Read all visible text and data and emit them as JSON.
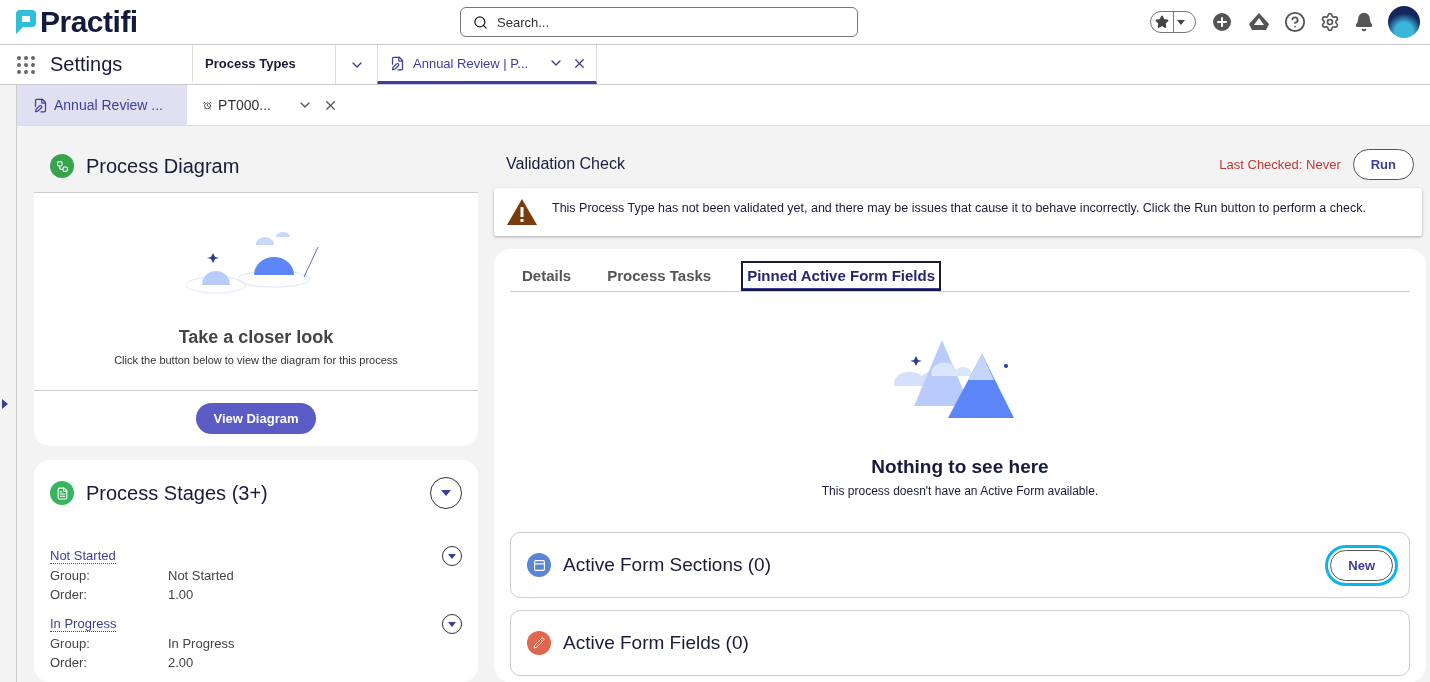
{
  "header": {
    "logo": "Practifi",
    "search": {
      "placeholder": "Search..."
    }
  },
  "nav": {
    "app_name": "Settings",
    "tabs": [
      {
        "label": "Process Types",
        "selected": false,
        "kind": "menu"
      },
      {
        "label": "Annual Review | P...",
        "selected": true,
        "kind": "record"
      }
    ]
  },
  "subtabs": [
    {
      "label": "Annual Review ...",
      "selected": true,
      "kind": "record"
    },
    {
      "label": "PT000...",
      "selected": false,
      "kind": "alarm"
    }
  ],
  "diagram_card": {
    "title": "Process Diagram",
    "empty_title": "Take a closer look",
    "empty_text": "Click the button below to view the diagram for this process",
    "button": "View Diagram"
  },
  "stages_card": {
    "title": "Process Stages (3+)",
    "stages": [
      {
        "name": "Not Started",
        "fields": [
          {
            "label": "Group:",
            "value": "Not Started"
          },
          {
            "label": "Order:",
            "value": "1.00"
          }
        ]
      },
      {
        "name": "In Progress",
        "fields": [
          {
            "label": "Group:",
            "value": "In Progress"
          },
          {
            "label": "Order:",
            "value": "2.00"
          }
        ]
      }
    ]
  },
  "validation": {
    "title": "Validation Check",
    "last_checked": "Last Checked: Never",
    "button": "Run",
    "warning": "This Process Type has not been validated yet, and there may be issues that cause it to behave incorrectly. Click the Run button to perform a check."
  },
  "detail_tabs": [
    {
      "label": "Details",
      "selected": false,
      "focused": false
    },
    {
      "label": "Process Tasks",
      "selected": false,
      "focused": false
    },
    {
      "label": "Pinned Active Form Fields",
      "selected": true,
      "focused": true
    }
  ],
  "empty_state": {
    "title": "Nothing to see here",
    "text": "This process doesn't have an Active Form available."
  },
  "related_lists": [
    {
      "title": "Active Form Sections (0)",
      "kind": "sections",
      "button": "New",
      "button_focused": true
    },
    {
      "title": "Active Form Fields (0)",
      "kind": "fields"
    }
  ]
}
